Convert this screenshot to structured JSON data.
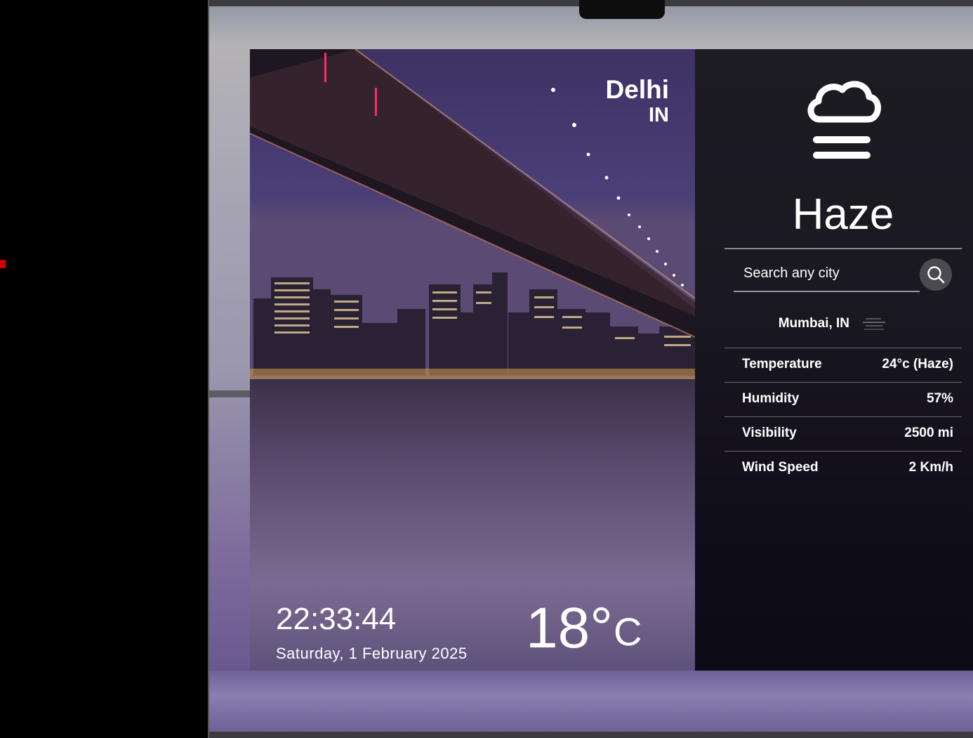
{
  "location": {
    "city": "Delhi",
    "country": "IN"
  },
  "time": {
    "clock": "22:33:44",
    "date": "Saturday, 1 February 2025"
  },
  "current_temp": {
    "value": "18°",
    "unit": "C"
  },
  "weather": {
    "condition": "Haze",
    "icon": "haze-icon"
  },
  "search": {
    "placeholder": "Search any city"
  },
  "recent": {
    "label": "Mumbai, IN",
    "icon": "haze-icon"
  },
  "stats": [
    {
      "label": "Temperature",
      "value": "24°c (Haze)"
    },
    {
      "label": "Humidity",
      "value": "57%"
    },
    {
      "label": "Visibility",
      "value": "2500 mi"
    },
    {
      "label": "Wind Speed",
      "value": "2 Km/h"
    }
  ],
  "colors": {
    "panel_bg": "#1a1820",
    "text": "#ffffff",
    "divider": "#8c8a92",
    "search_button": "#4a4a50"
  }
}
